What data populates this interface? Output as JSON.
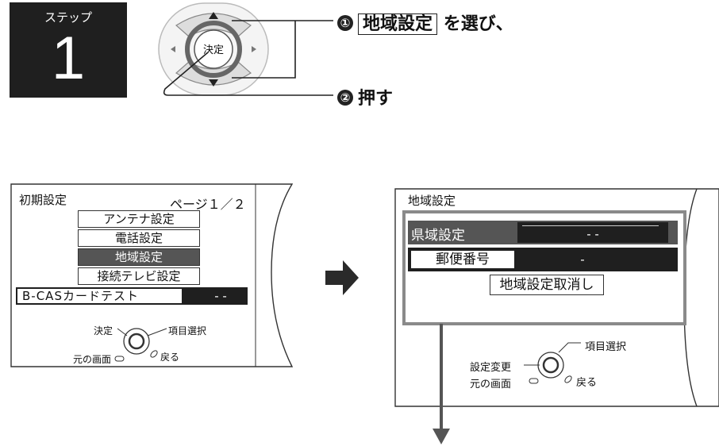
{
  "step": {
    "label": "ステップ",
    "number": "1"
  },
  "remote": {
    "center_label": "決定",
    "up_icon": "up-triangle-icon",
    "down_icon": "down-triangle-icon"
  },
  "instructions": {
    "one": {
      "num": "①",
      "boxed": "地域設定",
      "rest": "を選び、"
    },
    "two": {
      "num": "②",
      "text": "押す"
    }
  },
  "screen1": {
    "title": "初期設定",
    "page": "ページ１／２",
    "items": [
      "アンテナ設定",
      "電話設定",
      "地域設定",
      "接続テレビ設定"
    ],
    "selected_index": 2,
    "bcas_label": "B‐CASカードテスト",
    "bcas_value": "‐ ‐",
    "guide": {
      "decide": "決定",
      "select": "項目選択",
      "prev": "元の画面",
      "back": "戻る"
    }
  },
  "screen2": {
    "title": "地域設定",
    "pref_label": "県域設定",
    "pref_value": "‐ ‐",
    "postal_label": "郵便番号",
    "postal_value": "‐",
    "cancel_label": "地域設定取消し",
    "guide": {
      "select": "項目選択",
      "change": "設定変更",
      "prev": "元の画面",
      "back": "戻る"
    }
  },
  "colors": {
    "dark": "#1f1f1f",
    "selected": "#555555",
    "highlight_border": "#8a8a8a",
    "arrow": "#555555"
  }
}
